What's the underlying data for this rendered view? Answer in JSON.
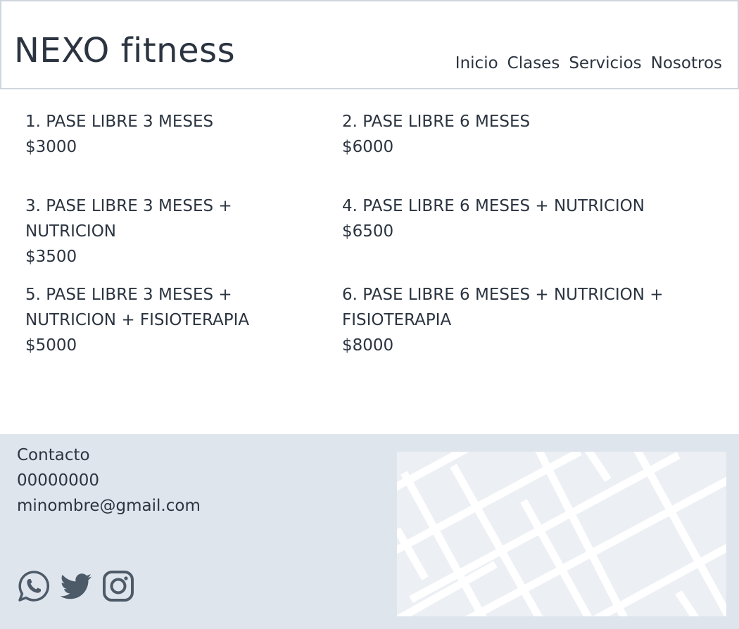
{
  "header": {
    "brand": "NEXO fitness",
    "nav": [
      "Inicio",
      "Clases",
      "Servicios",
      "Nosotros"
    ]
  },
  "plans": [
    {
      "title": "1. PASE LIBRE 3 MESES",
      "price": "$3000"
    },
    {
      "title": "2. PASE LIBRE 6 MESES",
      "price": "$6000"
    },
    {
      "title": "3. PASE LIBRE 3 MESES + NUTRICION",
      "price": "$3500"
    },
    {
      "title": "4. PASE LIBRE 6 MESES + NUTRICION",
      "price": "$6500"
    },
    {
      "title": "5. PASE LIBRE 3 MESES + NUTRICION + FISIOTERAPIA",
      "price": "$5000"
    },
    {
      "title": "6. PASE LIBRE 6 MESES + NUTRICION + FISIOTERAPIA",
      "price": "$8000"
    }
  ],
  "footer": {
    "contact_title": "Contacto",
    "phone": "00000000",
    "email": "minombre@gmail.com",
    "social_icons": [
      "whatsapp-icon",
      "twitter-icon",
      "instagram-icon"
    ]
  },
  "colors": {
    "text": "#2b3440",
    "footer_bg": "#dfe5ed",
    "icon": "#4d5a68"
  }
}
